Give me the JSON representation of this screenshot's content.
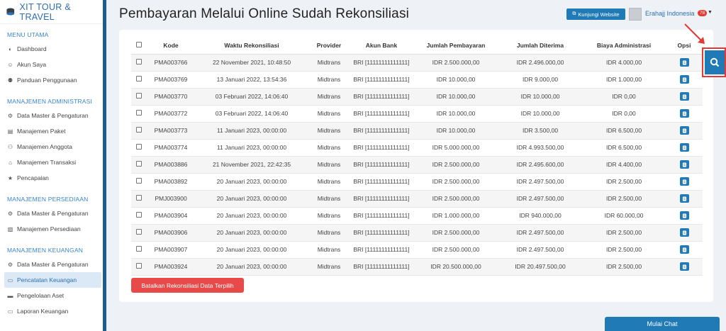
{
  "brand": {
    "title": "XIT TOUR & TRAVEL"
  },
  "sidebar": {
    "sections": [
      {
        "label": "MENU UTAMA",
        "items": [
          {
            "label": "Dashboard",
            "icon": "palette-icon"
          },
          {
            "label": "Akun Saya",
            "icon": "user-icon"
          },
          {
            "label": "Panduan Penggunaan",
            "icon": "map-pin-icon"
          }
        ]
      },
      {
        "label": "MANAJEMEN ADMINISTRASI",
        "items": [
          {
            "label": "Data Master & Pengaturan",
            "icon": "gears-icon"
          },
          {
            "label": "Manajemen Paket",
            "icon": "book-icon"
          },
          {
            "label": "Manajemen Anggota",
            "icon": "users-icon"
          },
          {
            "label": "Manajemen Transaksi",
            "icon": "cart-icon"
          },
          {
            "label": "Pencapaian",
            "icon": "star-icon"
          }
        ]
      },
      {
        "label": "MANAJEMEN PERSEDIAAN",
        "items": [
          {
            "label": "Data Master & Pengaturan",
            "icon": "gears-icon"
          },
          {
            "label": "Manajemen Persediaan",
            "icon": "cubes-icon"
          }
        ]
      },
      {
        "label": "MANAJEMEN KEUANGAN",
        "items": [
          {
            "label": "Data Master & Pengaturan",
            "icon": "gears-icon"
          },
          {
            "label": "Pencatatan Keuangan",
            "icon": "money-icon",
            "active": true
          },
          {
            "label": "Pengelolaan Aset",
            "icon": "hdd-icon"
          },
          {
            "label": "Laporan Keuangan",
            "icon": "laptop-icon"
          }
        ]
      }
    ]
  },
  "header": {
    "title": "Pembayaran Melalui Online Sudah Rekonsiliasi",
    "visit_label": "Kunjungi Website",
    "user_name": "Erahajj Indonesia",
    "notif_count": "78"
  },
  "table": {
    "headers": [
      "Kode",
      "Waktu Rekonsiliasi",
      "Provider",
      "Akun Bank",
      "Jumlah Pembayaran",
      "Jumlah Diterima",
      "Biaya Administrasi",
      "Opsi"
    ],
    "rows": [
      [
        "PMA003766",
        "22 November 2021, 10:48:50",
        "Midtrans",
        "BRI [11111111111111]",
        "IDR 2.500.000,00",
        "IDR 2.496.000,00",
        "IDR 4.000,00"
      ],
      [
        "PMA003769",
        "13 Januari 2022, 13:54:36",
        "Midtrans",
        "BRI [11111111111111]",
        "IDR 10.000,00",
        "IDR 9.000,00",
        "IDR 1.000,00"
      ],
      [
        "PMA003770",
        "03 Februari 2022, 14:06:40",
        "Midtrans",
        "BRI [11111111111111]",
        "IDR 10.000,00",
        "IDR 10.000,00",
        "IDR 0,00"
      ],
      [
        "PMA003772",
        "03 Februari 2022, 14:06:40",
        "Midtrans",
        "BRI [11111111111111]",
        "IDR 10.000,00",
        "IDR 10.000,00",
        "IDR 0,00"
      ],
      [
        "PMA003773",
        "11 Januari 2023, 00:00:00",
        "Midtrans",
        "BRI [11111111111111]",
        "IDR 10.000,00",
        "IDR 3.500,00",
        "IDR 6.500,00"
      ],
      [
        "PMA003774",
        "11 Januari 2023, 00:00:00",
        "Midtrans",
        "BRI [11111111111111]",
        "IDR 5.000.000,00",
        "IDR 4.993.500,00",
        "IDR 6.500,00"
      ],
      [
        "PMA003886",
        "21 November 2021, 22:42:35",
        "Midtrans",
        "BRI [11111111111111]",
        "IDR 2.500.000,00",
        "IDR 2.495.600,00",
        "IDR 4.400,00"
      ],
      [
        "PMA003892",
        "20 Januari 2023, 00:00:00",
        "Midtrans",
        "BRI [11111111111111]",
        "IDR 2.500.000,00",
        "IDR 2.497.500,00",
        "IDR 2.500,00"
      ],
      [
        "PMJ003900",
        "20 Januari 2023, 00:00:00",
        "Midtrans",
        "BRI [11111111111111]",
        "IDR 2.500.000,00",
        "IDR 2.497.500,00",
        "IDR 2.500,00"
      ],
      [
        "PMA003904",
        "20 Januari 2023, 00:00:00",
        "Midtrans",
        "BRI [11111111111111]",
        "IDR 1.000.000,00",
        "IDR 940.000,00",
        "IDR 60.000,00"
      ],
      [
        "PMA003906",
        "20 Januari 2023, 00:00:00",
        "Midtrans",
        "BRI [11111111111111]",
        "IDR 2.500.000,00",
        "IDR 2.497.500,00",
        "IDR 2.500,00"
      ],
      [
        "PMA003907",
        "20 Januari 2023, 00:00:00",
        "Midtrans",
        "BRI [11111111111111]",
        "IDR 2.500.000,00",
        "IDR 2.497.500,00",
        "IDR 2.500,00"
      ],
      [
        "PMA003924",
        "20 Januari 2023, 00:00:00",
        "Midtrans",
        "BRI [11111111111111]",
        "IDR 20.500.000,00",
        "IDR 20.497.500,00",
        "IDR 2.500,00"
      ]
    ]
  },
  "actions": {
    "cancel_label": "Batalkan Rekonsiliasi Data Terpilih",
    "chat_label": "Mulai Chat"
  },
  "colors": {
    "primary": "#1f7ab5",
    "danger": "#e84a4a",
    "highlight": "#e53935"
  }
}
